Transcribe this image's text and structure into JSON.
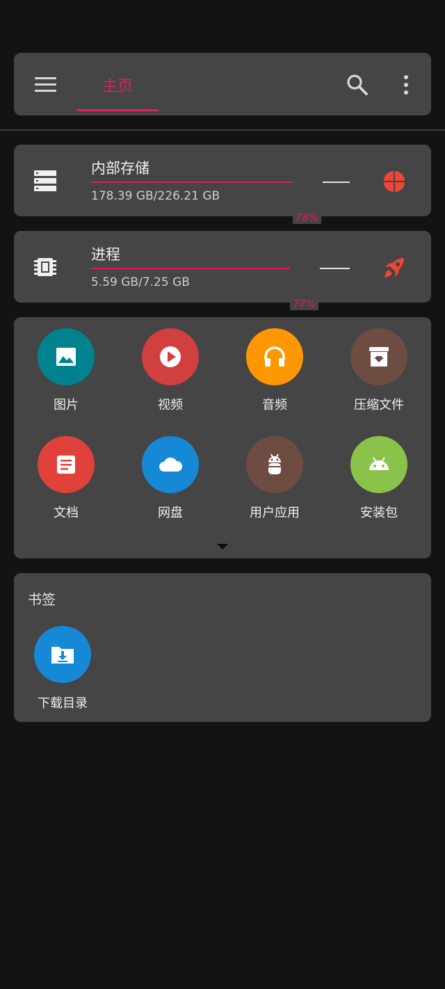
{
  "colors": {
    "accent": "#e0205a",
    "background": "#131313",
    "card": "#454545"
  },
  "toolbar": {
    "active_tab": "主页",
    "menu_icon": "menu-icon",
    "search_icon": "search-icon",
    "more_icon": "more-vert-icon"
  },
  "storage": {
    "internal": {
      "title": "内部存储",
      "percent_label": "78%",
      "used_fraction": 0.78,
      "size": "178.39 GB/226.21 GB",
      "icon": "storage-icon",
      "action_icon": "pie-chart-icon"
    },
    "process": {
      "title": "进程",
      "percent_label": "77%",
      "used_fraction": 0.77,
      "size": "5.59 GB/7.25 GB",
      "icon": "memory-chip-icon",
      "action_icon": "rocket-icon"
    }
  },
  "categories": [
    {
      "label": "图片",
      "icon": "image-icon",
      "color": "#00838f"
    },
    {
      "label": "视频",
      "icon": "play-icon",
      "color": "#d13f3f"
    },
    {
      "label": "音频",
      "icon": "headphones-icon",
      "color": "#ff9800"
    },
    {
      "label": "压缩文件",
      "icon": "archive-icon",
      "color": "#6d4c41"
    },
    {
      "label": "文档",
      "icon": "document-icon",
      "color": "#e0413a"
    },
    {
      "label": "网盘",
      "icon": "cloud-icon",
      "color": "#1689d6"
    },
    {
      "label": "用户应用",
      "icon": "android-robot-icon",
      "color": "#6d4c41"
    },
    {
      "label": "安装包",
      "icon": "android-icon",
      "color": "#8bc34a"
    }
  ],
  "bookmarks": {
    "heading": "书签",
    "items": [
      {
        "label": "下载目录",
        "icon": "download-folder-icon",
        "color": "#1689d6"
      }
    ]
  }
}
